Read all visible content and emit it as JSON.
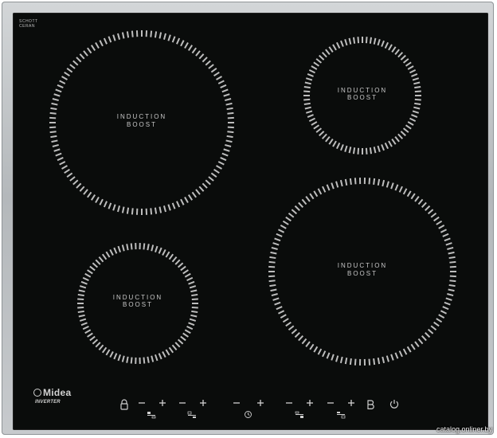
{
  "glass_brand": {
    "line1": "SCHOTT",
    "line2": "CERAN"
  },
  "zones": [
    {
      "id": "rear-left",
      "line1": "INDUCTION",
      "line2": "BOOST"
    },
    {
      "id": "rear-right",
      "line1": "INDUCTION",
      "line2": "BOOST"
    },
    {
      "id": "front-left",
      "line1": "INDUCTION",
      "line2": "BOOST"
    },
    {
      "id": "front-right",
      "line1": "INDUCTION",
      "line2": "BOOST"
    }
  ],
  "brand": {
    "name": "Midea",
    "tagline": "INVERTER"
  },
  "controls": {
    "lock_icon": "lock-icon",
    "minus_symbol": "–",
    "plus_symbol": "+",
    "boost_symbol": "B",
    "power_icon": "power-icon",
    "timer_icon": "clock-icon"
  },
  "watermark": "catalog.onliner.by",
  "colors": {
    "glass": "#0a0c0b",
    "frame": "#c0c4c7",
    "markings": "#c8c8c8"
  }
}
